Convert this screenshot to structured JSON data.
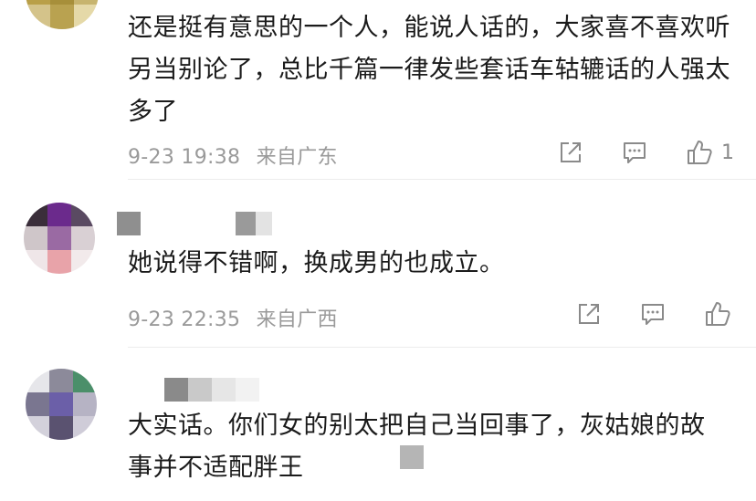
{
  "comments": [
    {
      "text": "还是挺有意思的一个人，能说人话的，大家喜不喜欢听另当别论了，总比千篇一律发些套话车轱辘话的人强太多了",
      "time": "9-23 19:38",
      "location": "来自广东",
      "like_count": "1"
    },
    {
      "text": "她说得不错啊，换成男的也成立。",
      "time": "9-23 22:35",
      "location": "来自广西",
      "like_count": ""
    },
    {
      "text": "大实话。你们女的别太把自己当回事了，灰姑娘的故事并不适配胖王",
      "time": "",
      "location": "",
      "like_count": ""
    }
  ],
  "colors": {
    "text": "#1b1b1b",
    "meta": "#9a9a9a",
    "icon": "#8a8a8a",
    "divider": "#ececec"
  },
  "icons": [
    "share-icon",
    "comment-icon",
    "like-icon"
  ]
}
